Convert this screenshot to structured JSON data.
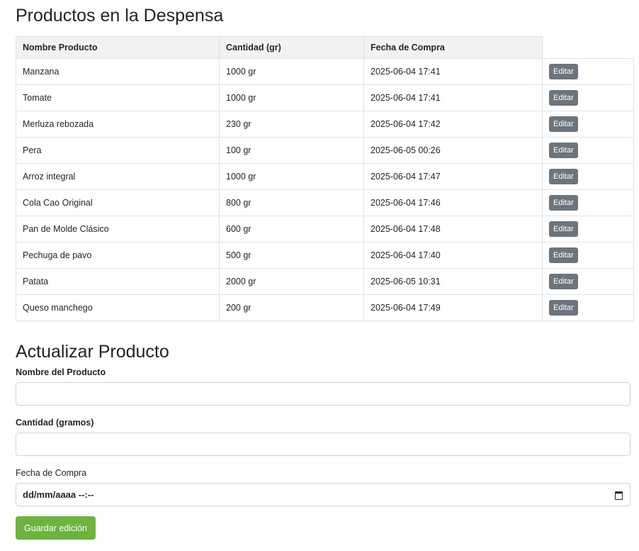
{
  "title": "Productos en la Despensa",
  "table": {
    "headers": [
      "Nombre Producto",
      "Cantidad (gr)",
      "Fecha de Compra"
    ],
    "edit_label": "Editar",
    "rows": [
      [
        "Manzana",
        "1000 gr",
        "2025-06-04 17:41"
      ],
      [
        "Tomate",
        "1000 gr",
        "2025-06-04 17:41"
      ],
      [
        "Merluza rebozada",
        "230 gr",
        "2025-06-04 17:42"
      ],
      [
        "Pera",
        "100 gr",
        "2025-06-05 00:26"
      ],
      [
        "Arroz integral",
        "1000 gr",
        "2025-06-04 17:47"
      ],
      [
        "Cola Cao Original",
        "800 gr",
        "2025-06-04 17:46"
      ],
      [
        "Pan de Molde Clásico",
        "600 gr",
        "2025-06-04 17:48"
      ],
      [
        "Pechuga de pavo",
        "500 gr",
        "2025-06-04 17:40"
      ],
      [
        "Patata",
        "2000 gr",
        "2025-06-05 10:31"
      ],
      [
        "Queso manchego",
        "200 gr",
        "2025-06-04 17:49"
      ]
    ]
  },
  "form": {
    "title": "Actualizar Producto",
    "name_label": "Nombre del Producto",
    "name_value": "",
    "qty_label": "Cantidad (gramos)",
    "qty_value": "",
    "date_label": "Fecha de Compra",
    "date_placeholder": "dd/mm/aaaa --:--",
    "save_label": "Guardar edición"
  }
}
